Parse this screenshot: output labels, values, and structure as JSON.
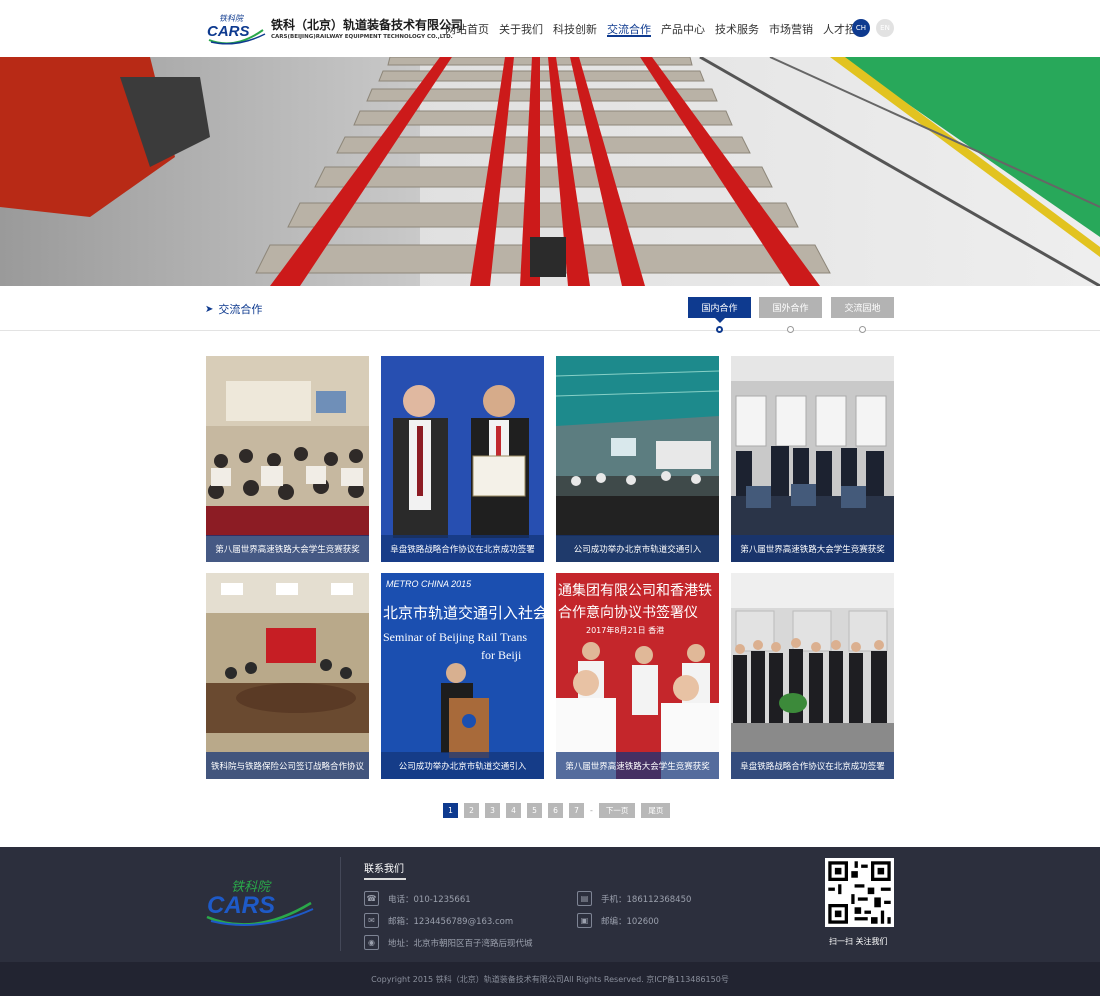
{
  "brand": {
    "name_cn": "铁科（北京）轨道装备技术有限公司",
    "name_en": "CARS(BEIJING)RAILWAY EQUIPMENT TECHNOLOGY CO.,LTD.",
    "logo_word": "CARS",
    "logo_script": "铁科院",
    "primary_color": "#0e3a8f"
  },
  "nav": {
    "items": [
      "网站首页",
      "关于我们",
      "科技创新",
      "交流合作",
      "产品中心",
      "技术服务",
      "市场营销",
      "人才招聘"
    ],
    "active_index": 3
  },
  "lang": {
    "ch": "CH",
    "en": "EN"
  },
  "section": {
    "title": "交流合作",
    "tabs": [
      "国内合作",
      "国外合作",
      "交流园地"
    ],
    "active_tab": 0
  },
  "cards": [
    {
      "caption": "第八届世界高速铁路大会学生竞赛获奖"
    },
    {
      "caption": "阜盘铁路战略合作协议在北京成功签署"
    },
    {
      "caption": "公司成功举办北京市轨道交通引入"
    },
    {
      "caption": "第八届世界高速铁路大会学生竞赛获奖"
    },
    {
      "caption": "铁科院与铁路保险公司签订战略合作协议"
    },
    {
      "caption": "公司成功举办北京市轨道交通引入"
    },
    {
      "caption": "第八届世界高速铁路大会学生竞赛获奖"
    },
    {
      "caption": "阜盘铁路战略合作协议在北京成功签署"
    }
  ],
  "card_texts": {
    "seminar_cn": "北京市轨道交通引入社会资",
    "seminar_en1": "Seminar of Beijing Rail Trans",
    "seminar_en2": "for Beiji",
    "metro": "METRO CHINA 2015",
    "signing1": "通集团有限公司和香港铁",
    "signing2": "合作意向协议书签署仪",
    "signing_date": "2017年8月21日 香港"
  },
  "pagination": {
    "pages": [
      "1",
      "2",
      "3",
      "4",
      "5",
      "6",
      "7"
    ],
    "active": 0,
    "ellipsis": "-",
    "next": "下一页",
    "last": "尾页"
  },
  "footer": {
    "contact_title": "联系我们",
    "phone": "电话：010-1235661",
    "mobile": "手机：18611236845​0",
    "email": "邮箱：1234456789@163.com",
    "postcode": "邮编：102600",
    "address": "地址：北京市朝阳区百子湾路后现代城",
    "qr_caption": "扫一扫  关注我们",
    "copyright": "Copyright 2015 铁科（北京）轨道装备技术有限公司All Rights Reserved. 京ICP备113486150号"
  }
}
